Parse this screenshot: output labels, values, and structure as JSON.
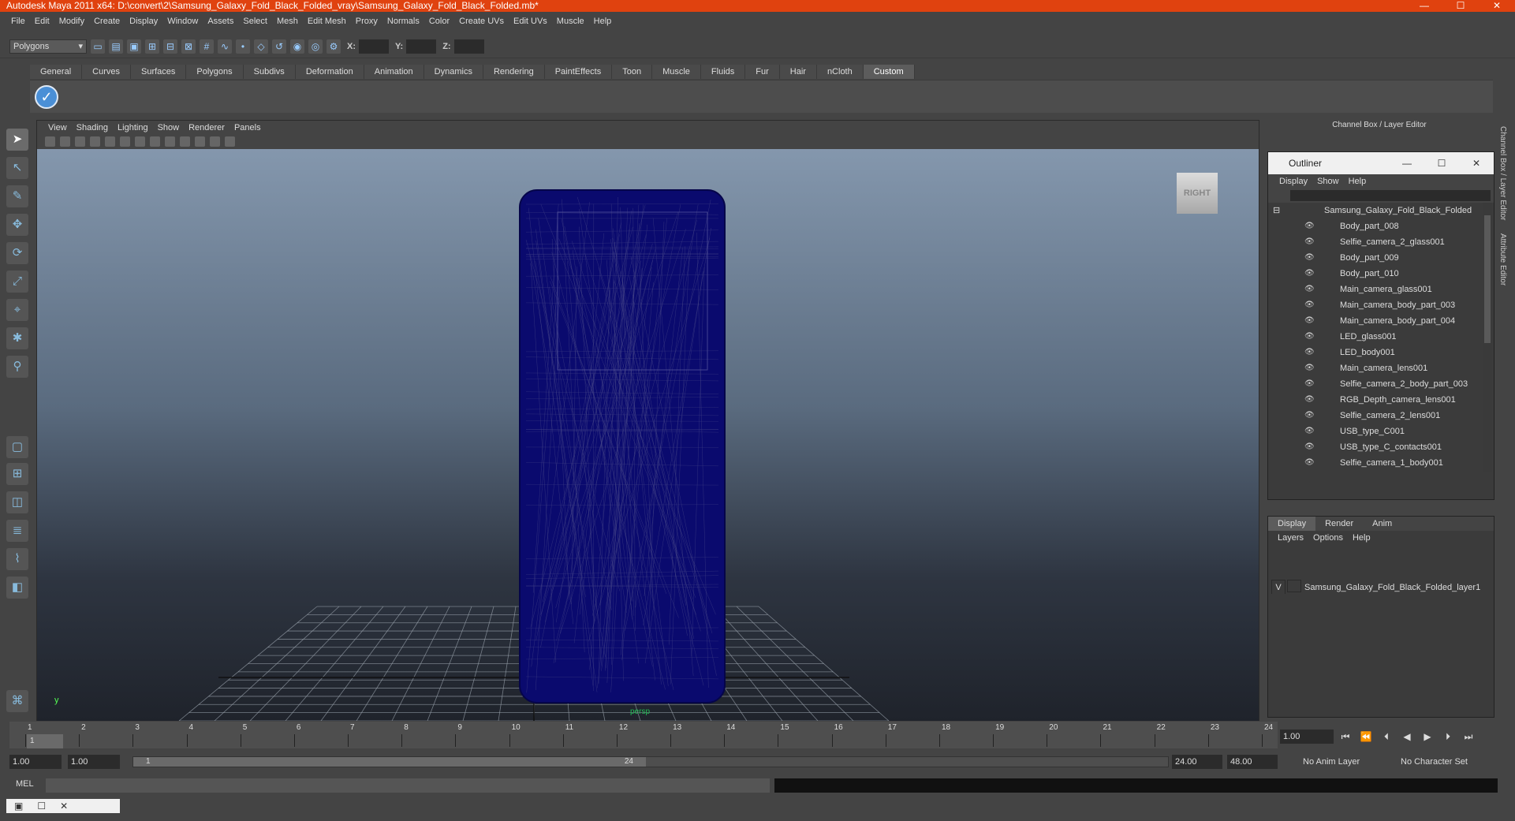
{
  "window": {
    "title": "Autodesk Maya 2011 x64: D:\\convert\\2\\Samsung_Galaxy_Fold_Black_Folded_vray\\Samsung_Galaxy_Fold_Black_Folded.mb*",
    "minimize": "—",
    "maximize": "☐",
    "close": "✕"
  },
  "menubar": [
    "File",
    "Edit",
    "Modify",
    "Create",
    "Display",
    "Window",
    "Assets",
    "Select",
    "Mesh",
    "Edit Mesh",
    "Proxy",
    "Normals",
    "Color",
    "Create UVs",
    "Edit UVs",
    "Muscle",
    "Help"
  ],
  "statusline": {
    "mode": "Polygons",
    "x_label": "X:",
    "y_label": "Y:",
    "z_label": "Z:"
  },
  "shelf": {
    "tabs": [
      "General",
      "Curves",
      "Surfaces",
      "Polygons",
      "Subdivs",
      "Deformation",
      "Animation",
      "Dynamics",
      "Rendering",
      "PaintEffects",
      "Toon",
      "Muscle",
      "Fluids",
      "Fur",
      "Hair",
      "nCloth",
      "Custom"
    ],
    "active_tab": "Custom",
    "icon": "checkmark-icon"
  },
  "viewport": {
    "menus": [
      "View",
      "Shading",
      "Lighting",
      "Show",
      "Renderer",
      "Panels"
    ],
    "viewcube_label": "RIGHT",
    "camera_label": "persp",
    "axis_label": "y"
  },
  "right_dock": {
    "header": "Channel Box / Layer Editor",
    "side_tabs": [
      "Channel Box / Layer Editor",
      "Attribute Editor"
    ]
  },
  "outliner": {
    "title": "Outliner",
    "menus": [
      "Display",
      "Show",
      "Help"
    ],
    "root": "Samsung_Galaxy_Fold_Black_Folded",
    "items": [
      "Body_part_008",
      "Selfie_camera_2_glass001",
      "Body_part_009",
      "Body_part_010",
      "Main_camera_glass001",
      "Main_camera_body_part_003",
      "Main_camera_body_part_004",
      "LED_glass001",
      "LED_body001",
      "Main_camera_lens001",
      "Selfie_camera_2_body_part_003",
      "RGB_Depth_camera_lens001",
      "Selfie_camera_2_lens001",
      "USB_type_C001",
      "USB_type_C_contacts001",
      "Selfie_camera_1_body001"
    ]
  },
  "layer_editor": {
    "tabs": [
      "Display",
      "Render",
      "Anim"
    ],
    "active_tab": "Display",
    "menus": [
      "Layers",
      "Options",
      "Help"
    ],
    "layer_visible": "V",
    "layer_name": "Samsung_Galaxy_Fold_Black_Folded_layer1"
  },
  "timeline": {
    "ticks": [
      "1",
      "2",
      "3",
      "4",
      "5",
      "6",
      "7",
      "8",
      "9",
      "10",
      "11",
      "12",
      "13",
      "14",
      "15",
      "16",
      "17",
      "18",
      "19",
      "20",
      "21",
      "22",
      "23",
      "24"
    ],
    "current_frame_marker": "1",
    "current_frame": "1.00"
  },
  "range": {
    "start": "1.00",
    "anim_start": "1.00",
    "range_start_label": "1",
    "range_end_label": "24",
    "end": "24.00",
    "anim_end": "48.00",
    "anim_layer": "No Anim Layer",
    "character_set": "No Character Set"
  },
  "command_line": {
    "label": "MEL"
  },
  "colors": {
    "titlebar": "#e0420f",
    "wireframe": "#0a0a6e",
    "ui_bg": "#444444"
  }
}
